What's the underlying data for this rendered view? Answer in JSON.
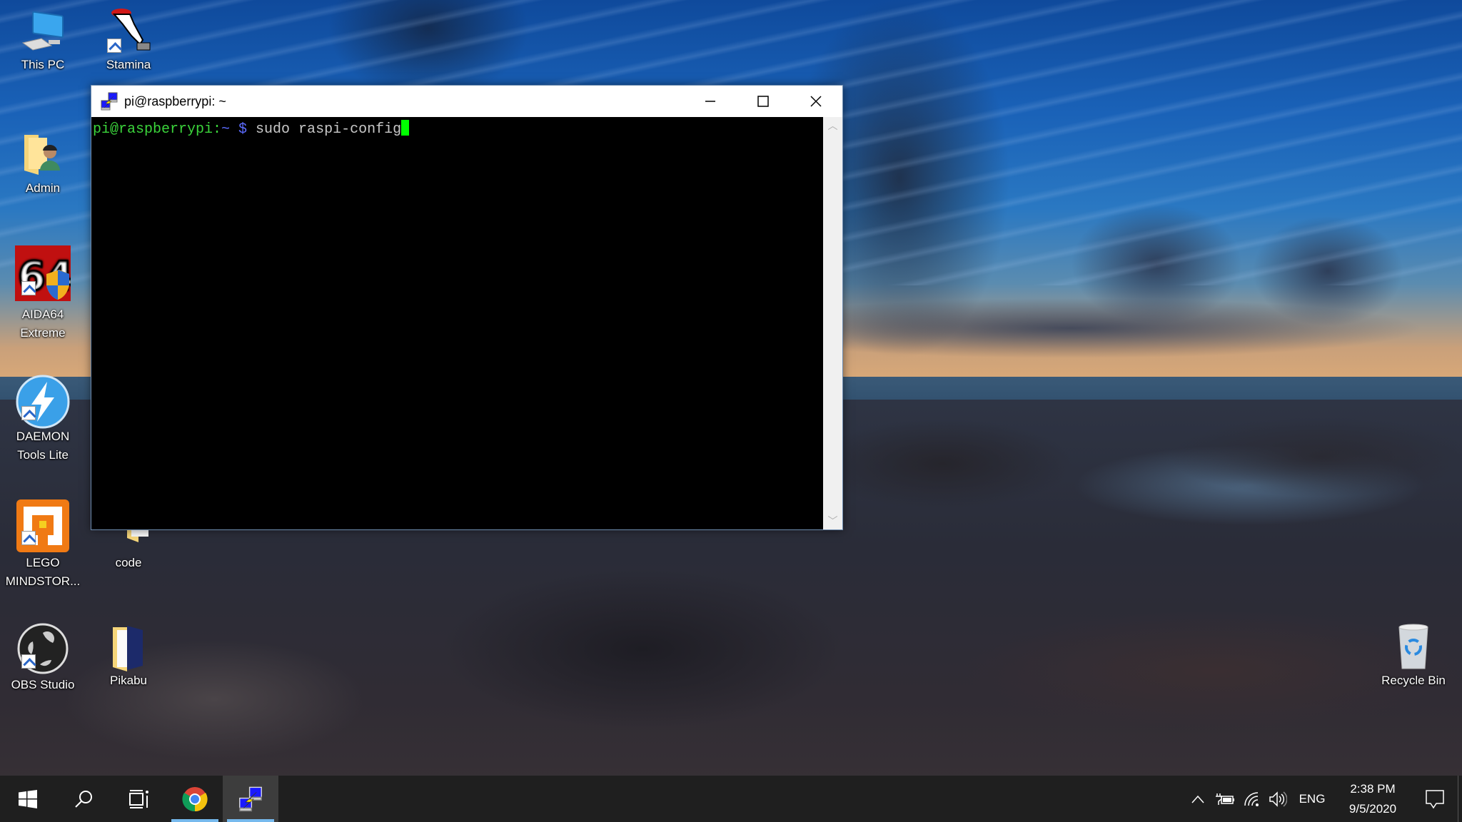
{
  "desktop": {
    "icons": [
      {
        "label": "This PC",
        "icon": "computer-icon",
        "shortcut": false
      },
      {
        "label": "Stamina",
        "icon": "stamina-hand-icon",
        "shortcut": true
      },
      {
        "label": "Admin",
        "icon": "user-folder-icon",
        "shortcut": false
      },
      {
        "label": "AIDA64 Extreme",
        "line1": "AIDA64",
        "line2": "Extreme",
        "icon": "aida64-icon",
        "shortcut": true
      },
      {
        "label": "DAEMON Tools Lite",
        "line1": "DAEMON",
        "line2": "Tools Lite",
        "icon": "daemon-tools-icon",
        "shortcut": true
      },
      {
        "label": "LEGO MINDSTOR...",
        "line1": "LEGO",
        "line2": "MINDSTOR...",
        "icon": "lego-mindstorms-icon",
        "shortcut": true
      },
      {
        "label": "code",
        "icon": "folder-icon",
        "shortcut": false
      },
      {
        "label": "OBS Studio",
        "icon": "obs-icon",
        "shortcut": true
      },
      {
        "label": "Pikabu",
        "icon": "folder-icon",
        "shortcut": false
      },
      {
        "label": "Recycle Bin",
        "icon": "recycle-bin-icon",
        "shortcut": false
      }
    ]
  },
  "window": {
    "title": "pi@raspberrypi: ~",
    "controls": {
      "minimize": "minimize",
      "maximize": "maximize",
      "close": "close"
    },
    "terminal": {
      "prompt_user": "pi@raspberrypi:",
      "prompt_path": "~ $",
      "command": " sudo raspi-config"
    },
    "colors": {
      "prompt_user": "#3bd43b",
      "prompt_path": "#5c6cff",
      "command": "#c8c8c8",
      "cursor": "#00ff00"
    }
  },
  "taskbar": {
    "buttons": [
      {
        "name": "start",
        "icon": "windows-logo-icon"
      },
      {
        "name": "search",
        "icon": "search-icon"
      },
      {
        "name": "task-view",
        "icon": "task-view-icon"
      },
      {
        "name": "chrome",
        "icon": "chrome-icon",
        "running": true
      },
      {
        "name": "putty",
        "icon": "putty-icon",
        "running": true,
        "active": true
      }
    ],
    "tray": {
      "language": "ENG",
      "time": "2:38 PM",
      "date": "9/5/2020"
    },
    "accent": "#76b9ed"
  }
}
